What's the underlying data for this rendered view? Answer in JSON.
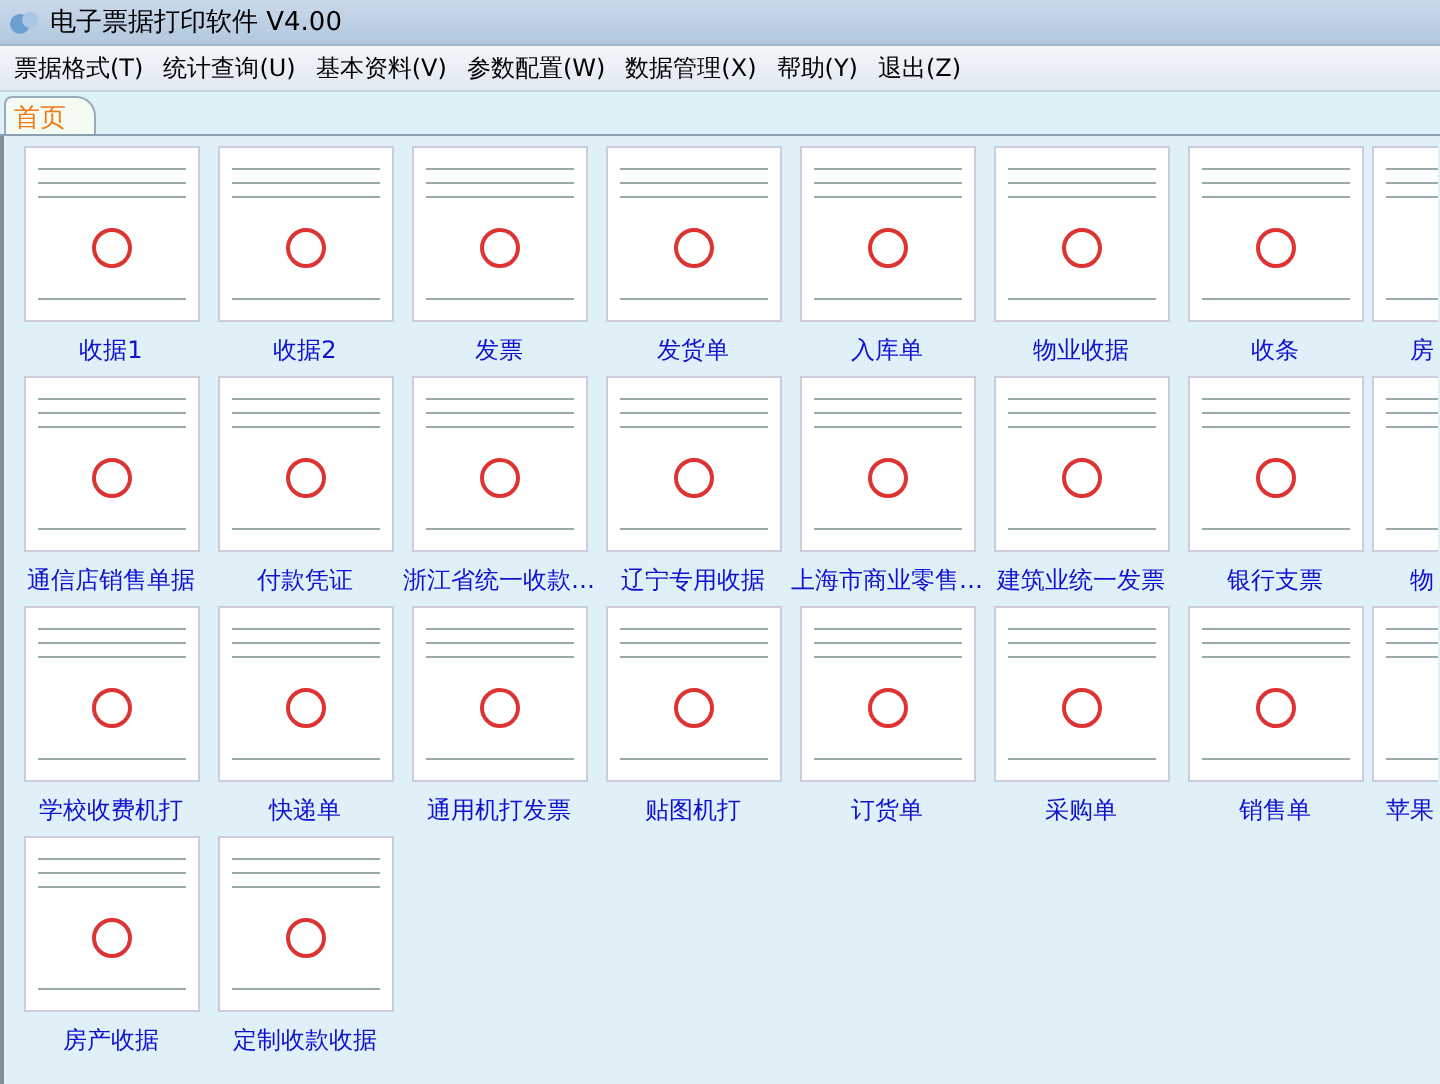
{
  "window": {
    "title": "电子票据打印软件 V4.00"
  },
  "menu": [
    "票据格式(T)",
    "统计查询(U)",
    "基本资料(V)",
    "参数配置(W)",
    "数据管理(X)",
    "帮助(Y)",
    "退出(Z)"
  ],
  "tabs": [
    {
      "label": "首页",
      "selected": true
    }
  ],
  "templates": [
    {
      "label": "收据1"
    },
    {
      "label": "收据2"
    },
    {
      "label": "发票"
    },
    {
      "label": "发货单"
    },
    {
      "label": "入库单"
    },
    {
      "label": "物业收据"
    },
    {
      "label": "收条"
    },
    {
      "label": "房"
    },
    {
      "label": "通信店销售单据"
    },
    {
      "label": "付款凭证"
    },
    {
      "label": "浙江省统一收款…"
    },
    {
      "label": "辽宁专用收据"
    },
    {
      "label": "上海市商业零售…"
    },
    {
      "label": "建筑业统一发票"
    },
    {
      "label": "银行支票"
    },
    {
      "label": "物"
    },
    {
      "label": "学校收费机打"
    },
    {
      "label": "快递单"
    },
    {
      "label": "通用机打发票"
    },
    {
      "label": "贴图机打"
    },
    {
      "label": "订货单"
    },
    {
      "label": "采购单"
    },
    {
      "label": "销售单"
    },
    {
      "label": "苹果"
    },
    {
      "label": "房产收据"
    },
    {
      "label": "定制收款收据"
    }
  ]
}
